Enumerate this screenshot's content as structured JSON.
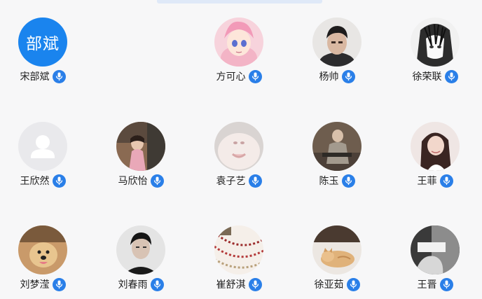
{
  "colors": {
    "accent": "#2a7fe8",
    "background": "#f7f7f8",
    "text_avatar": "#1a84ee"
  },
  "members": [
    {
      "name": "宋部斌",
      "avatar_type": "text",
      "avatar_text": "部斌",
      "mic_icon": "microphone-icon"
    },
    {
      "name": "方可心",
      "avatar_type": "image",
      "avatar_desc": "anime-girl-avatar",
      "mic_icon": "microphone-icon"
    },
    {
      "name": "杨帅",
      "avatar_type": "image",
      "avatar_desc": "man-photo-avatar",
      "mic_icon": "microphone-icon"
    },
    {
      "name": "徐荣联",
      "avatar_type": "image",
      "avatar_desc": "manga-character-avatar",
      "mic_icon": "microphone-icon"
    },
    {
      "name": "王欣然",
      "avatar_type": "default",
      "avatar_desc": "default-user-avatar",
      "mic_icon": "microphone-icon"
    },
    {
      "name": "马欣怡",
      "avatar_type": "image",
      "avatar_desc": "street-photo-avatar",
      "mic_icon": "microphone-icon"
    },
    {
      "name": "袁子艺",
      "avatar_type": "image",
      "avatar_desc": "cat-closeup-avatar",
      "mic_icon": "microphone-icon"
    },
    {
      "name": "陈玉",
      "avatar_type": "image",
      "avatar_desc": "person-in-chair-avatar",
      "mic_icon": "microphone-icon"
    },
    {
      "name": "王菲",
      "avatar_type": "image",
      "avatar_desc": "woman-portrait-avatar",
      "mic_icon": "microphone-icon"
    },
    {
      "name": "刘梦滢",
      "avatar_type": "image",
      "avatar_desc": "dog-avatar",
      "mic_icon": "microphone-icon"
    },
    {
      "name": "刘春雨",
      "avatar_type": "image",
      "avatar_desc": "man-black-white-avatar",
      "mic_icon": "microphone-icon"
    },
    {
      "name": "崔舒淇",
      "avatar_type": "image",
      "avatar_desc": "bead-decoration-avatar",
      "mic_icon": "microphone-icon"
    },
    {
      "name": "徐亚茹",
      "avatar_type": "image",
      "avatar_desc": "sleeping-cat-avatar",
      "mic_icon": "microphone-icon"
    },
    {
      "name": "王晋",
      "avatar_type": "image",
      "avatar_desc": "hand-with-note-avatar",
      "mic_icon": "microphone-icon"
    }
  ]
}
